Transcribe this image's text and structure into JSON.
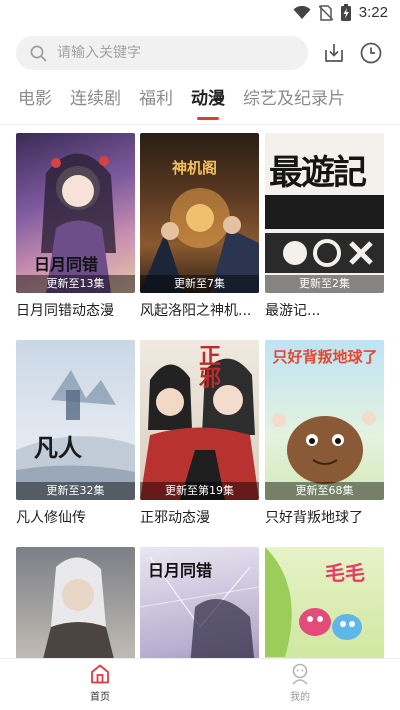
{
  "status_bar": {
    "time": "3:22"
  },
  "search": {
    "placeholder": "请输入关键字"
  },
  "tabs": [
    {
      "label": "电影",
      "active": false
    },
    {
      "label": "连续剧",
      "active": false
    },
    {
      "label": "福利",
      "active": false
    },
    {
      "label": "动漫",
      "active": true
    },
    {
      "label": "综艺及纪录片",
      "active": false
    }
  ],
  "cards": [
    {
      "title": "日月同错动态漫",
      "badge": "更新至13集",
      "poster_text": "日月同错"
    },
    {
      "title": "风起洛阳之神机...",
      "badge": "更新至7集",
      "poster_text": "神机阁"
    },
    {
      "title": "最游记...",
      "badge": "更新至2集",
      "poster_text": "最遊記"
    },
    {
      "title": "凡人修仙传",
      "badge": "更新至32集",
      "poster_text": "凡人"
    },
    {
      "title": "正邪动态漫",
      "badge": "更新至第19集",
      "poster_text": "正邪"
    },
    {
      "title": "只好背叛地球了",
      "badge": "更新至68集",
      "poster_text": "只好背叛地球了"
    },
    {
      "title": "",
      "badge": "",
      "poster_text": ""
    },
    {
      "title": "",
      "badge": "",
      "poster_text": "日月同错"
    },
    {
      "title": "",
      "badge": "",
      "poster_text": "毛毛"
    }
  ],
  "bottom_nav": {
    "home_label": "首页",
    "mine_label": "我的"
  },
  "colors": {
    "accent": "#e23b3b",
    "tab_inactive": "#8b8b8b",
    "search_bg": "#f1f1f1"
  }
}
